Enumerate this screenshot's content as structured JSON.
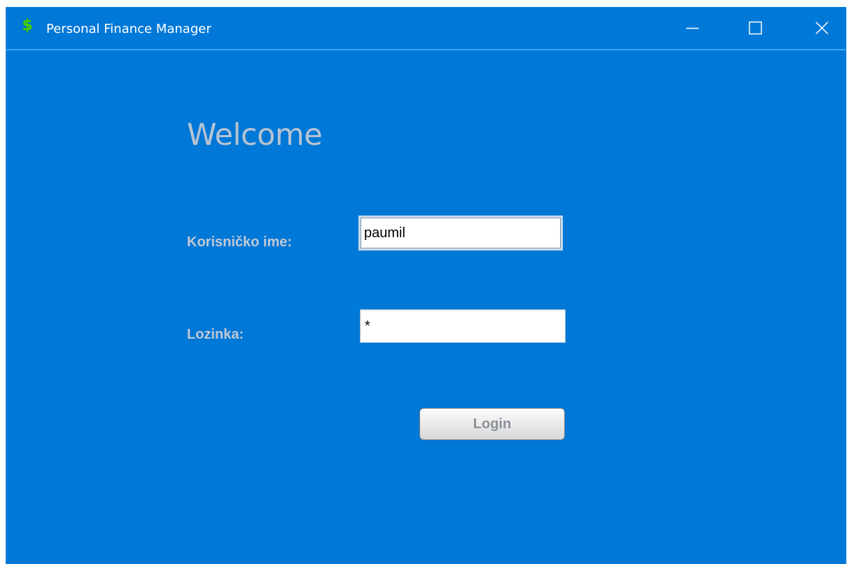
{
  "window": {
    "title": "Personal Finance Manager",
    "app_icon": "dollar-sign-icon",
    "app_icon_glyph": "$",
    "app_icon_color": "#46d000",
    "background_color": "#0078d7",
    "controls": {
      "minimize": "minimize-icon",
      "maximize": "maximize-icon",
      "close": "close-icon"
    }
  },
  "login_form": {
    "heading": "Welcome",
    "username_label": "Korisničko ime:",
    "username_value": "paumil",
    "password_label": "Lozinka:",
    "password_value": "*",
    "login_button_label": "Login"
  }
}
